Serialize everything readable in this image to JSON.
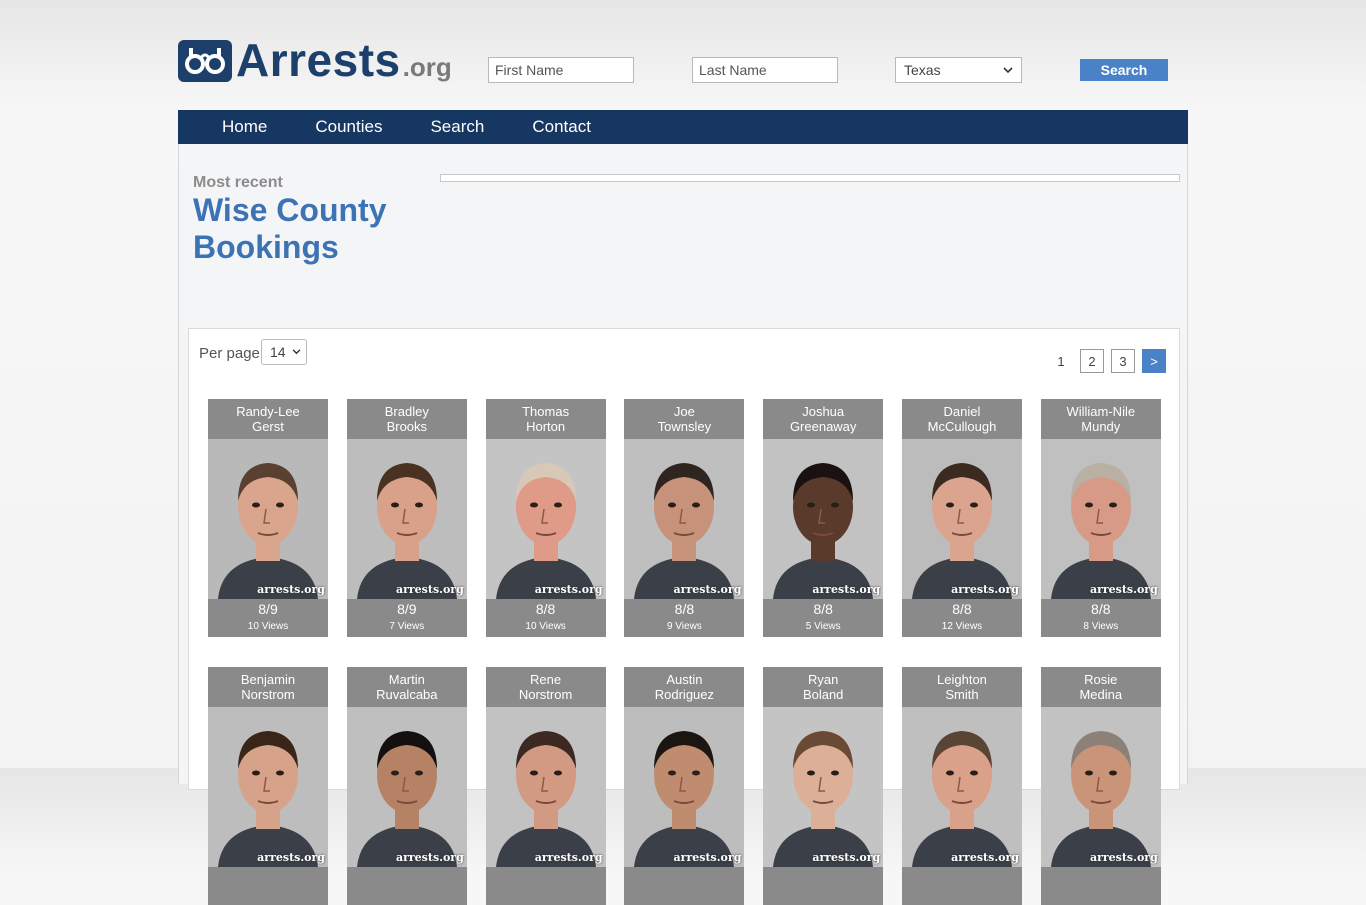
{
  "header": {
    "logo_text": "Arrests",
    "logo_suffix": ".org",
    "first_name_placeholder": "First Name",
    "last_name_placeholder": "Last Name",
    "state_selected": "Texas",
    "search_label": "Search"
  },
  "nav": {
    "items": [
      {
        "label": "Home"
      },
      {
        "label": "Counties"
      },
      {
        "label": "Search"
      },
      {
        "label": "Contact"
      }
    ]
  },
  "main": {
    "most_recent": "Most recent",
    "title": "Wise County Bookings",
    "per_page_label": "Per page",
    "per_page_value": "14",
    "pagination": [
      "1",
      "2",
      "3",
      ">"
    ],
    "watermark": "arrests.org"
  },
  "bookings": [
    {
      "first": "Randy-Lee",
      "last": "Gerst",
      "date": "8/9",
      "views": "10 Views",
      "skin": "#d9a58c",
      "hair": "#5a4030",
      "bg": "#b9b9b9"
    },
    {
      "first": "Bradley",
      "last": "Brooks",
      "date": "8/9",
      "views": "7 Views",
      "skin": "#d9a08a",
      "hair": "#4a3222",
      "bg": "#bdbdbd"
    },
    {
      "first": "Thomas",
      "last": "Horton",
      "date": "8/8",
      "views": "10 Views",
      "skin": "#e09a88",
      "hair": "#d8c8b8",
      "bg": "#c4c4c4"
    },
    {
      "first": "Joe",
      "last": "Townsley",
      "date": "8/8",
      "views": "9 Views",
      "skin": "#c7927a",
      "hair": "#2e2420",
      "bg": "#bfbfbf"
    },
    {
      "first": "Joshua",
      "last": "Greenaway",
      "date": "8/8",
      "views": "5 Views",
      "skin": "#5a3a2a",
      "hair": "#1a1210",
      "bg": "#c2c2c2"
    },
    {
      "first": "Daniel",
      "last": "McCullough",
      "date": "8/8",
      "views": "12 Views",
      "skin": "#dba48e",
      "hair": "#3a2a20",
      "bg": "#bcbcbc"
    },
    {
      "first": "William-Nile",
      "last": "Mundy",
      "date": "8/8",
      "views": "8 Views",
      "skin": "#d69a86",
      "hair": "#b9b0a4",
      "bg": "#c0c0c0"
    },
    {
      "first": "Benjamin",
      "last": "Norstrom",
      "date": "",
      "views": "",
      "skin": "#d6a38a",
      "hair": "#3a2618",
      "bg": "#bdbdbd"
    },
    {
      "first": "Martin",
      "last": "Ruvalcaba",
      "date": "",
      "views": "",
      "skin": "#b58266",
      "hair": "#141010",
      "bg": "#bfbfbf"
    },
    {
      "first": "Rene",
      "last": "Norstrom",
      "date": "",
      "views": "",
      "skin": "#d29a82",
      "hair": "#3c2a22",
      "bg": "#c2c2c2"
    },
    {
      "first": "Austin",
      "last": "Rodriguez",
      "date": "",
      "views": "",
      "skin": "#c08c70",
      "hair": "#1c1612",
      "bg": "#bdbdbd"
    },
    {
      "first": "Ryan",
      "last": "Boland",
      "date": "",
      "views": "",
      "skin": "#dcb098",
      "hair": "#6a4a34",
      "bg": "#c4c4c4"
    },
    {
      "first": "Leighton",
      "last": "Smith",
      "date": "",
      "views": "",
      "skin": "#d9a08a",
      "hair": "#5a4434",
      "bg": "#bfbfbf"
    },
    {
      "first": "Rosie",
      "last": "Medina",
      "date": "",
      "views": "",
      "skin": "#c99478",
      "hair": "#8c8078",
      "bg": "#c2c2c2"
    }
  ]
}
